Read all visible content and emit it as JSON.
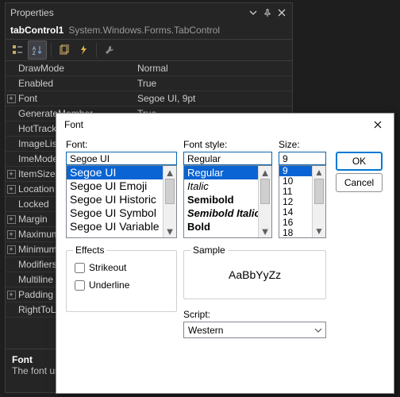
{
  "properties": {
    "title": "Properties",
    "object_name": "tabControl1",
    "object_type": "System.Windows.Forms.TabControl",
    "toolbar": {
      "cat": "categorized-icon",
      "alpha": "alphabetical-icon",
      "prop": "property-pages-icon",
      "events": "events-icon",
      "messages": "wrench-icon"
    },
    "rows": [
      {
        "expand": "",
        "name": "DrawMode",
        "value": "Normal"
      },
      {
        "expand": "",
        "name": "Enabled",
        "value": "True"
      },
      {
        "expand": "+",
        "name": "Font",
        "value": "Segoe UI, 9pt"
      },
      {
        "expand": "",
        "name": "GenerateMember",
        "value": "True"
      },
      {
        "expand": "",
        "name": "HotTrack",
        "value": ""
      },
      {
        "expand": "",
        "name": "ImageList",
        "value": ""
      },
      {
        "expand": "",
        "name": "ImeMode",
        "value": ""
      },
      {
        "expand": "+",
        "name": "ItemSize",
        "value": ""
      },
      {
        "expand": "+",
        "name": "Location",
        "value": ""
      },
      {
        "expand": "",
        "name": "Locked",
        "value": ""
      },
      {
        "expand": "+",
        "name": "Margin",
        "value": ""
      },
      {
        "expand": "+",
        "name": "MaximumSize",
        "value": ""
      },
      {
        "expand": "+",
        "name": "MinimumSize",
        "value": ""
      },
      {
        "expand": "",
        "name": "Modifiers",
        "value": ""
      },
      {
        "expand": "",
        "name": "Multiline",
        "value": ""
      },
      {
        "expand": "+",
        "name": "Padding",
        "value": ""
      },
      {
        "expand": "",
        "name": "RightToLeft",
        "value": ""
      }
    ],
    "description": {
      "title": "Font",
      "text": "The font used to display text in the control."
    }
  },
  "dialog": {
    "title": "Font",
    "font_label": "Font:",
    "style_label": "Font style:",
    "size_label": "Size:",
    "font_value": "Segoe UI",
    "style_value": "Regular",
    "size_value": "9",
    "fonts": [
      "Segoe UI",
      "Segoe UI Emoji",
      "Segoe UI Historic",
      "Segoe UI Symbol",
      "Segoe UI Variable"
    ],
    "font_selected": 0,
    "styles": [
      "Regular",
      "Italic",
      "Semibold",
      "Semibold Italic",
      "Bold"
    ],
    "style_selected": 0,
    "sizes": [
      "9",
      "10",
      "11",
      "12",
      "14",
      "16",
      "18"
    ],
    "size_selected": 0,
    "ok": "OK",
    "cancel": "Cancel",
    "effects_label": "Effects",
    "strikeout": "Strikeout",
    "underline": "Underline",
    "sample_label": "Sample",
    "sample_text": "AaBbYyZz",
    "script_label": "Script:",
    "script_value": "Western"
  }
}
